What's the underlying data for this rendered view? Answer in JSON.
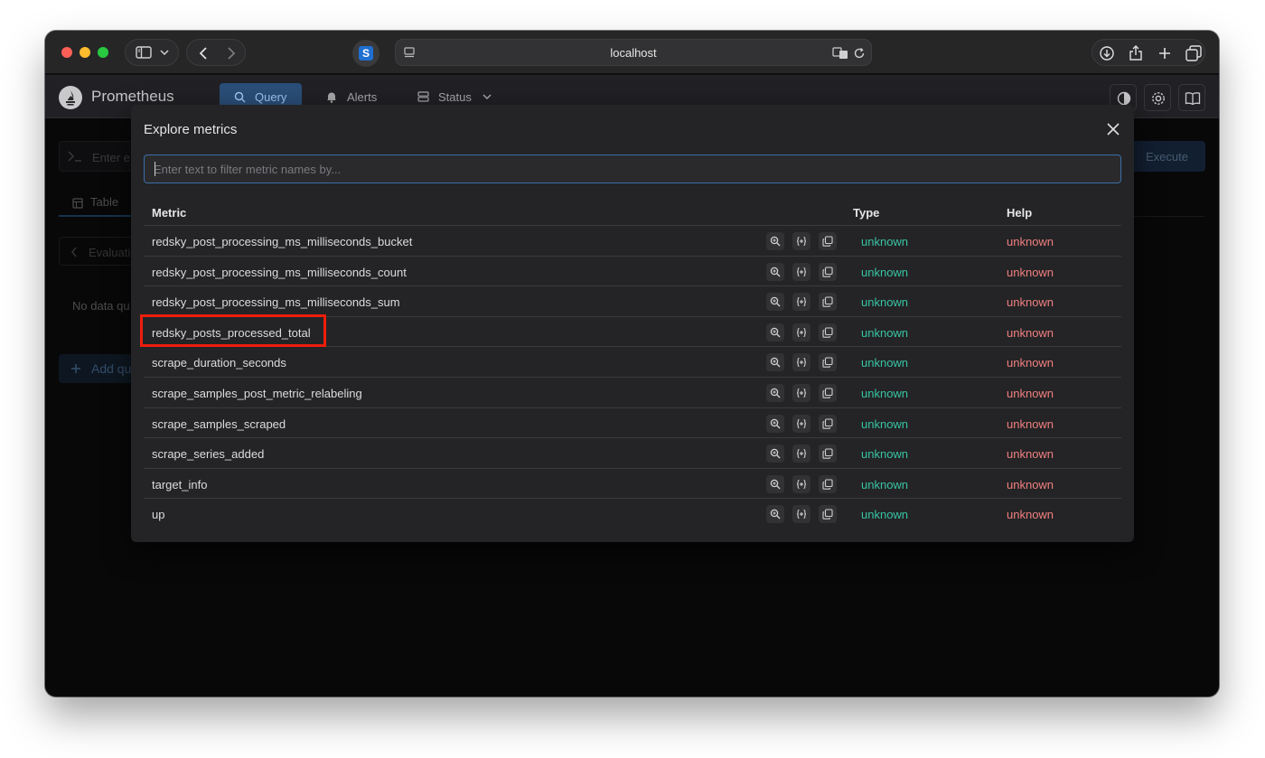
{
  "browser": {
    "url": "localhost"
  },
  "app": {
    "brand": "Prometheus",
    "nav": {
      "query": "Query",
      "alerts": "Alerts",
      "status": "Status"
    }
  },
  "background_page": {
    "expression_placeholder": "Enter e",
    "execute_label": "Execute",
    "table_tab": "Table",
    "evaluation_label": "Evaluatio",
    "no_data_text": "No data qu",
    "add_query_label": "Add qu"
  },
  "modal": {
    "title": "Explore metrics",
    "filter_placeholder": "Enter text to filter metric names by...",
    "columns": {
      "metric": "Metric",
      "type": "Type",
      "help": "Help"
    },
    "rows": [
      {
        "metric": "redsky_post_processing_ms_milliseconds_bucket",
        "type": "unknown",
        "help": "unknown"
      },
      {
        "metric": "redsky_post_processing_ms_milliseconds_count",
        "type": "unknown",
        "help": "unknown"
      },
      {
        "metric": "redsky_post_processing_ms_milliseconds_sum",
        "type": "unknown",
        "help": "unknown"
      },
      {
        "metric": "redsky_posts_processed_total",
        "type": "unknown",
        "help": "unknown"
      },
      {
        "metric": "scrape_duration_seconds",
        "type": "unknown",
        "help": "unknown"
      },
      {
        "metric": "scrape_samples_post_metric_relabeling",
        "type": "unknown",
        "help": "unknown"
      },
      {
        "metric": "scrape_samples_scraped",
        "type": "unknown",
        "help": "unknown"
      },
      {
        "metric": "scrape_series_added",
        "type": "unknown",
        "help": "unknown"
      },
      {
        "metric": "target_info",
        "type": "unknown",
        "help": "unknown"
      },
      {
        "metric": "up",
        "type": "unknown",
        "help": "unknown"
      }
    ],
    "row_action_icons": [
      "zoom-icon",
      "braces-insert-icon",
      "copy-icon"
    ]
  },
  "colors": {
    "type_unknown": "#38c4a4",
    "help_unknown": "#f07f7f",
    "highlight": "#ee1d0c",
    "accent": "#2a4e78"
  }
}
